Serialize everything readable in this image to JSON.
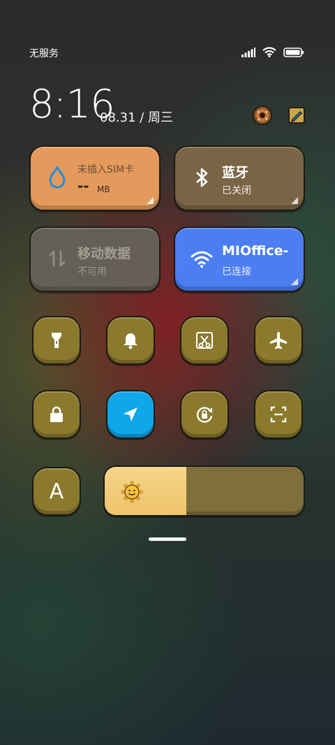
{
  "status_bar": {
    "carrier": "无服务",
    "icons": [
      "signal-icon",
      "wifi-icon",
      "battery-icon"
    ]
  },
  "header": {
    "time": "8:16",
    "date": "08.31 / 周三",
    "icons": [
      "settings-donut-icon",
      "edit-icon"
    ]
  },
  "tiles": {
    "data_usage": {
      "title": "未插入SIM卡",
      "value": "--",
      "unit": "MB",
      "color": "#e49a5c"
    },
    "bluetooth": {
      "title": "蓝牙",
      "status": "已关闭",
      "color": "#7a6446"
    },
    "mobile_data": {
      "title": "移动数据",
      "status": "不可用",
      "color": "#66645a"
    },
    "wifi": {
      "title": "MIOffice-",
      "status": "已连接",
      "color": "#4c7ef2"
    }
  },
  "toggles": [
    {
      "name": "flashlight",
      "active": false
    },
    {
      "name": "notification",
      "active": false
    },
    {
      "name": "screenshot",
      "active": false
    },
    {
      "name": "airplane-mode",
      "active": false
    },
    {
      "name": "lock-screen",
      "active": false
    },
    {
      "name": "location",
      "active": true
    },
    {
      "name": "auto-rotate",
      "active": false
    },
    {
      "name": "scanner",
      "active": false
    }
  ],
  "auto_brightness": {
    "label": "A"
  },
  "brightness": {
    "level_fraction": 0.41
  },
  "colors": {
    "toggle_bg": "#8b7a2d",
    "active_bg": "#10a6ea"
  }
}
